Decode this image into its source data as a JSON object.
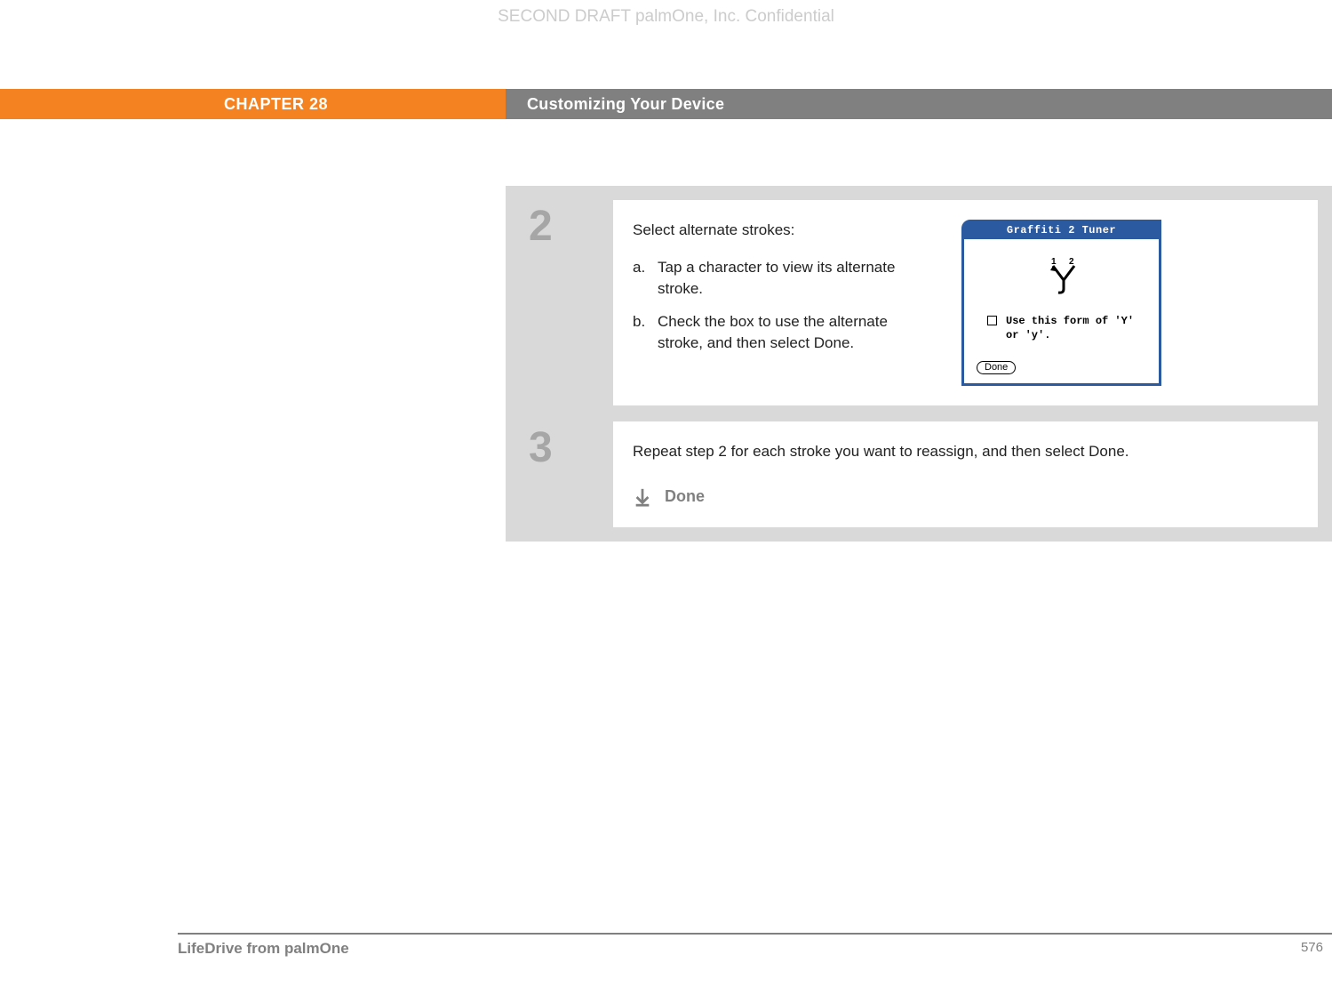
{
  "watermark": "SECOND DRAFT palmOne, Inc.  Confidential",
  "header": {
    "chapter": "CHAPTER 28",
    "title": "Customizing Your Device"
  },
  "steps": [
    {
      "number": "2",
      "intro": "Select alternate strokes:",
      "items": [
        {
          "marker": "a.",
          "text": "Tap a character to view its alternate stroke."
        },
        {
          "marker": "b.",
          "text": "Check the box to use the alternate stroke, and then select Done."
        }
      ],
      "dialog": {
        "title": "Graffiti 2 Tuner",
        "checkbox_label": "Use this form of 'Y' or 'y'.",
        "done_button": "Done",
        "label_1": "1",
        "label_2": "2"
      }
    },
    {
      "number": "3",
      "text": "Repeat step 2 for each stroke you want to reassign, and then select Done.",
      "done_label": "Done"
    }
  ],
  "footer": {
    "product": "LifeDrive from palmOne",
    "page": "576"
  }
}
